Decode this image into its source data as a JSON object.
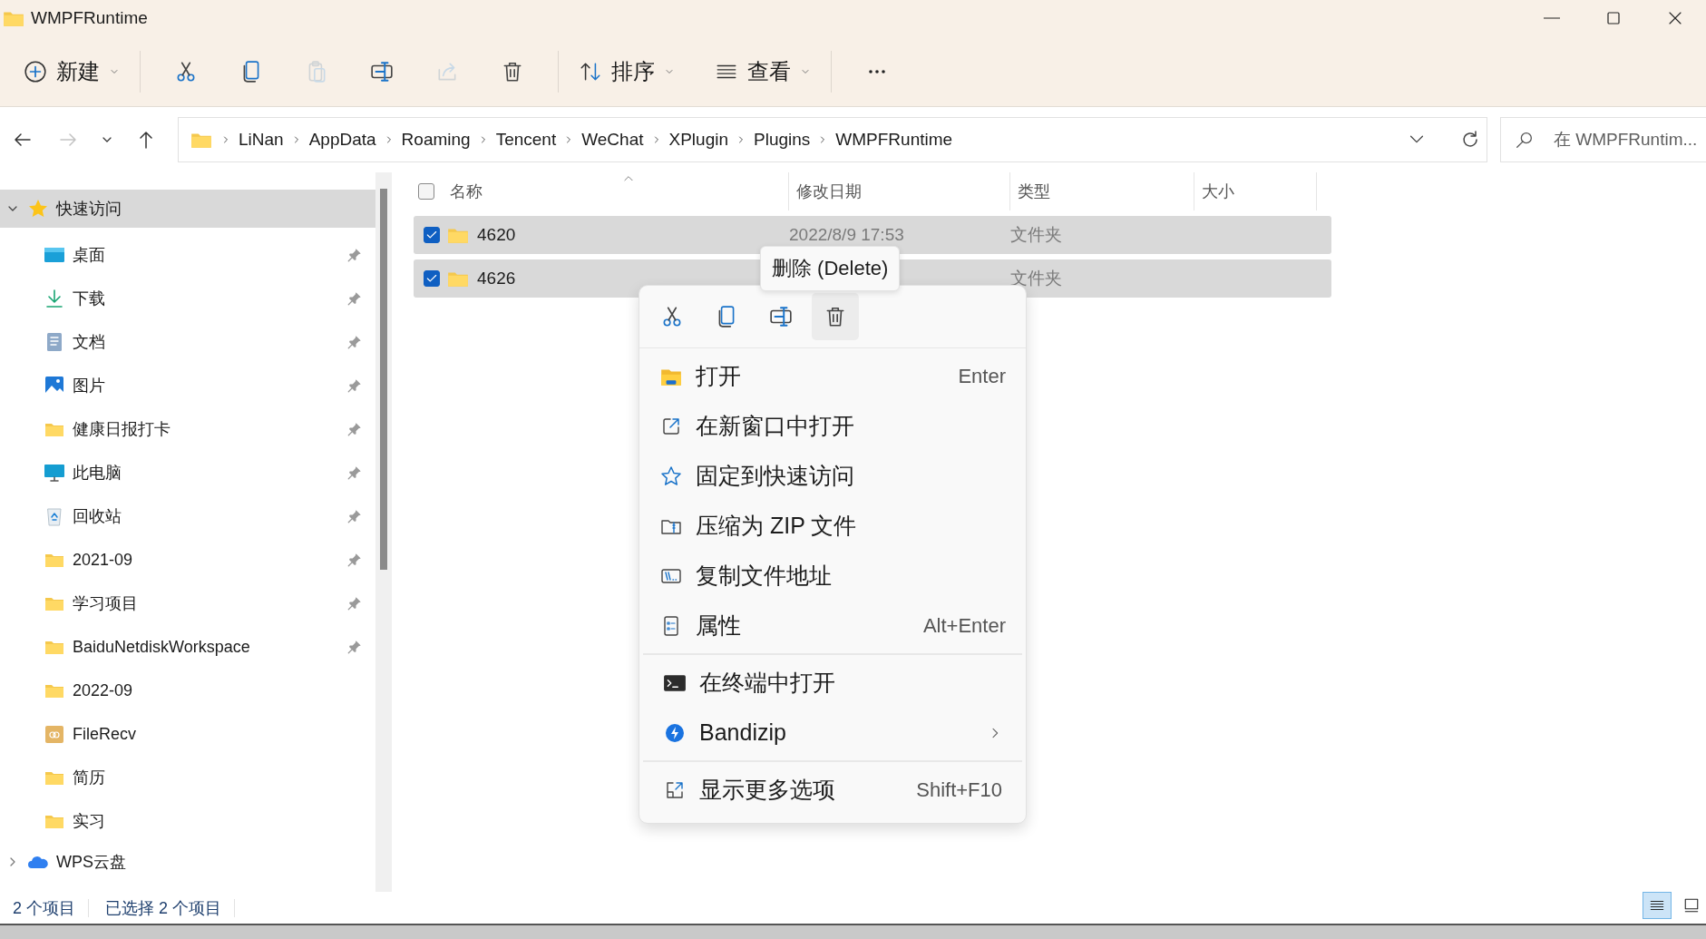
{
  "window": {
    "title": "WMPFRuntime"
  },
  "toolbar": {
    "new": {
      "label": "新建"
    },
    "edit_buttons": [
      {
        "disabled": false
      },
      {
        "disabled": false
      },
      {
        "disabled": true
      },
      {
        "disabled": false
      },
      {
        "disabled": true
      },
      {
        "disabled": false
      }
    ],
    "sort": {
      "label": "排序"
    },
    "view": {
      "label": "查看"
    }
  },
  "navigation": [
    {
      "disabled": false
    },
    {
      "disabled": true
    },
    {
      "disabled": false
    },
    {
      "disabled": false
    }
  ],
  "breadcrumbs": [
    "LiNan",
    "AppData",
    "Roaming",
    "Tencent",
    "WeChat",
    "XPlugin",
    "Plugins",
    "WMPFRuntime"
  ],
  "search": {
    "placeholder": "在 WMPFRuntim..."
  },
  "sidebar": [
    {
      "label": "快速访问",
      "expanded": true,
      "selected": true,
      "kind": "star",
      "children": [
        {
          "label": "桌面",
          "kind": "desktop",
          "pinned": true
        },
        {
          "label": "下载",
          "kind": "download",
          "pinned": true
        },
        {
          "label": "文档",
          "kind": "documents",
          "pinned": true
        },
        {
          "label": "图片",
          "kind": "pictures",
          "pinned": true
        },
        {
          "label": "健康日报打卡",
          "kind": "folder",
          "pinned": true
        },
        {
          "label": "此电脑",
          "kind": "computer",
          "pinned": true
        },
        {
          "label": "回收站",
          "kind": "recycle",
          "pinned": true
        },
        {
          "label": "2021-09",
          "kind": "folder",
          "pinned": true
        },
        {
          "label": "学习项目",
          "kind": "folder",
          "pinned": true
        },
        {
          "label": "BaiduNetdiskWorkspace",
          "kind": "folder",
          "pinned": true
        },
        {
          "label": "2022-09",
          "kind": "folder",
          "pinned": false
        },
        {
          "label": "FileRecv",
          "kind": "filerecv",
          "pinned": false
        },
        {
          "label": "简历",
          "kind": "folder",
          "pinned": false
        },
        {
          "label": "实习",
          "kind": "folder",
          "pinned": false
        }
      ]
    },
    {
      "label": "WPS云盘",
      "expanded": false,
      "selected": false,
      "kind": "cloud"
    }
  ],
  "table": {
    "all_checked": false,
    "columns": [
      "名称",
      "修改日期",
      "类型",
      "大小"
    ],
    "rows": [
      {
        "name": "4620",
        "date": "2022/8/9 17:53",
        "type": "文件夹",
        "selected": true,
        "checked": true
      },
      {
        "name": "4626",
        "type": "文件夹",
        "selected": true,
        "checked": true
      }
    ]
  },
  "tooltip": "删除 (Delete)",
  "context_menu": {
    "quick_actions": [
      {
        "selected": false
      },
      {
        "selected": false
      },
      {
        "selected": false
      },
      {
        "selected": true
      }
    ],
    "groups": [
      [
        {
          "label": "打开",
          "shortcut": "Enter",
          "kind": "open"
        },
        {
          "label": "在新窗口中打开",
          "kind": "new-window"
        },
        {
          "label": "固定到快速访问",
          "kind": "pin"
        },
        {
          "label": "压缩为 ZIP 文件",
          "kind": "zip"
        },
        {
          "label": "复制文件地址",
          "kind": "path"
        },
        {
          "label": "属性",
          "shortcut": "Alt+Enter",
          "kind": "properties"
        }
      ],
      [
        {
          "label": "在终端中打开",
          "kind": "terminal"
        },
        {
          "label": "Bandizip",
          "kind": "bandizip",
          "submenu": true
        }
      ],
      [
        {
          "label": "显示更多选项",
          "shortcut": "Shift+F10",
          "kind": "more"
        }
      ]
    ]
  },
  "status_bar": {
    "items": "2 个项目",
    "selection": "已选择 2 个项目"
  },
  "view_buttons": [
    {
      "selected": true
    },
    {
      "selected": false
    }
  ]
}
